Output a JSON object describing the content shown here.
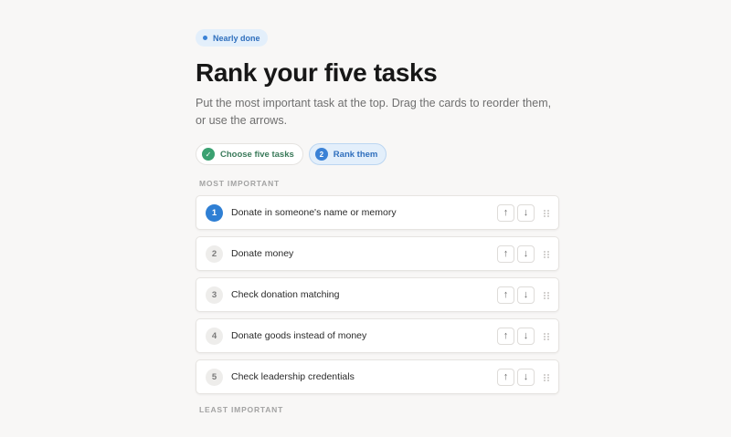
{
  "status_badge": {
    "label": "Nearly done"
  },
  "page": {
    "title": "Rank your five tasks",
    "subtitle": "Put the most important task at the top. Drag the cards to reorder them, or use the arrows."
  },
  "steps": [
    {
      "label": "Choose five tasks",
      "state": "complete",
      "icon": "check-icon"
    },
    {
      "label": "Rank them",
      "number": "2",
      "state": "active"
    }
  ],
  "sections": {
    "top_label": "MOST IMPORTANT",
    "bottom_label": "LEAST IMPORTANT"
  },
  "tasks": [
    {
      "rank": "1",
      "label": "Donate in someone's name or memory"
    },
    {
      "rank": "2",
      "label": "Donate money"
    },
    {
      "rank": "3",
      "label": "Check donation matching"
    },
    {
      "rank": "4",
      "label": "Donate goods instead of money"
    },
    {
      "rank": "5",
      "label": "Check leadership credentials"
    }
  ],
  "controls": {
    "up_glyph": "↑",
    "down_glyph": "↓",
    "check_glyph": "✓"
  },
  "colors": {
    "accent": "#2f7fd4",
    "complete": "#3aa171",
    "badge_bg": "#e3effb",
    "background": "#f8f7f6"
  }
}
